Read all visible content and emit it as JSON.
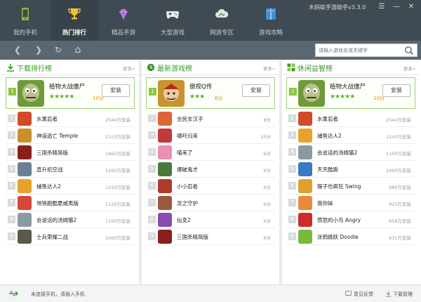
{
  "window": {
    "title": "木蚂蚁手游助手v3.3.0",
    "menu_glyph": "☰",
    "min_glyph": "—",
    "close_glyph": "✕"
  },
  "nav": {
    "tabs": [
      {
        "label": "我的手机",
        "icon": "phone-icon",
        "active": false
      },
      {
        "label": "热门排行",
        "icon": "trophy-icon",
        "active": true
      },
      {
        "label": "精品手游",
        "icon": "gem-icon",
        "active": false
      },
      {
        "label": "大型游戏",
        "icon": "gamepad-icon",
        "active": false
      },
      {
        "label": "网游专区",
        "icon": "cloud-icon",
        "active": false
      },
      {
        "label": "游戏攻略",
        "icon": "book-icon",
        "active": false
      }
    ]
  },
  "toolbar": {
    "back_glyph": "❮",
    "forward_glyph": "❯",
    "refresh_glyph": "↻",
    "home_glyph": "⌂",
    "search_placeholder": "请输入游戏名或关键字"
  },
  "colors": {
    "accent": "#3a9a2b",
    "topbar": "#3f4a52",
    "toolbar": "#5a6770",
    "score": "#e78a00"
  },
  "columns": [
    {
      "title": "下载排行榜",
      "icon": "download-arrow-icon",
      "more": "更多",
      "top": {
        "rank": "1",
        "name": "植物大战僵尸",
        "stars": "★★★★★",
        "score": "10分",
        "button": "安装",
        "icon_color": "#6f9a3b"
      },
      "rows": [
        {
          "rank": "2",
          "name": "水果忍者",
          "stat": "2544万安装",
          "color": "#d14a2a"
        },
        {
          "rank": "3",
          "name": "神庙逃亡 Temple",
          "stat": "2153万安装",
          "color": "#c8912d"
        },
        {
          "rank": "4",
          "name": "三国杀精简版",
          "stat": "1662万安装",
          "color": "#8a1f1a"
        },
        {
          "rank": "5",
          "name": "直升机空战",
          "stat": "1263万安装",
          "color": "#6d7f94"
        },
        {
          "rank": "6",
          "name": "捕鱼达人2",
          "stat": "1243万安装",
          "color": "#e8a22a"
        },
        {
          "rank": "7",
          "name": "地铁跑酷夏威夷版",
          "stat": "1129万安装",
          "color": "#d6473b"
        },
        {
          "rank": "8",
          "name": "会说话的汤姆猫2",
          "stat": "1100万安装",
          "color": "#8a9aa0"
        },
        {
          "rank": "9",
          "name": "士兵荣耀二战",
          "stat": "1060万安装",
          "color": "#5a5a4a"
        }
      ]
    },
    {
      "title": "最新游戏榜",
      "icon": "clock-icon",
      "more": "更多",
      "top": {
        "rank": "1",
        "name": "傲视Q传",
        "stars": "★★★",
        "score": "6分",
        "button": "安装",
        "icon_color": "#c8942e"
      },
      "rows": [
        {
          "rank": "2",
          "name": "全民女汉子",
          "stat": "8分",
          "color": "#e0633a"
        },
        {
          "rank": "3",
          "name": "哪吒归来",
          "stat": "10分",
          "color": "#c03a3a"
        },
        {
          "rank": "4",
          "name": "喵来了",
          "stat": "6分",
          "color": "#e98fb5"
        },
        {
          "rank": "5",
          "name": "爆破鬼才",
          "stat": "6分",
          "color": "#4a7a3a"
        },
        {
          "rank": "6",
          "name": "小小忍者",
          "stat": "6分",
          "color": "#b23a2a"
        },
        {
          "rank": "7",
          "name": "龙之守护",
          "stat": "6分",
          "color": "#9a5a3a"
        },
        {
          "rank": "8",
          "name": "仙变2",
          "stat": "6分",
          "color": "#8a4ab0"
        },
        {
          "rank": "9",
          "name": "三国杀精简版",
          "stat": "6分",
          "color": "#8a1f1a"
        }
      ]
    },
    {
      "title": "休闲益智榜",
      "icon": "puzzle-icon",
      "more": "更多",
      "top": {
        "rank": "1",
        "name": "植物大战僵尸",
        "stars": "★★★★★",
        "score": "10分",
        "button": "安装",
        "icon_color": "#6f9a3b"
      },
      "rows": [
        {
          "rank": "2",
          "name": "水果忍者",
          "stat": "2544万安装",
          "color": "#d14a2a"
        },
        {
          "rank": "3",
          "name": "捕鱼达人2",
          "stat": "1243万安装",
          "color": "#e8a22a"
        },
        {
          "rank": "4",
          "name": "会说话的汤姆猫2",
          "stat": "1100万安装",
          "color": "#8a9aa0"
        },
        {
          "rank": "5",
          "name": "天天酷跑",
          "stat": "1000万安装",
          "color": "#3a78c8"
        },
        {
          "rank": "6",
          "name": "猴子也疯狂 Swing",
          "stat": "989万安装",
          "color": "#e0a030"
        },
        {
          "rank": "7",
          "name": "我你妹",
          "stat": "923万安装",
          "color": "#e88a3a"
        },
        {
          "rank": "8",
          "name": "愤怒的小鸟 Angry",
          "stat": "858万安装",
          "color": "#d12a2a"
        },
        {
          "rank": "9",
          "name": "涂鸦跳跃 Doodle",
          "stat": "631万安装",
          "color": "#7ab83a"
        }
      ]
    }
  ],
  "status": {
    "connection": "未连接手机，请插入手机",
    "feedback": "意见反馈",
    "downloads": "下载管理"
  }
}
